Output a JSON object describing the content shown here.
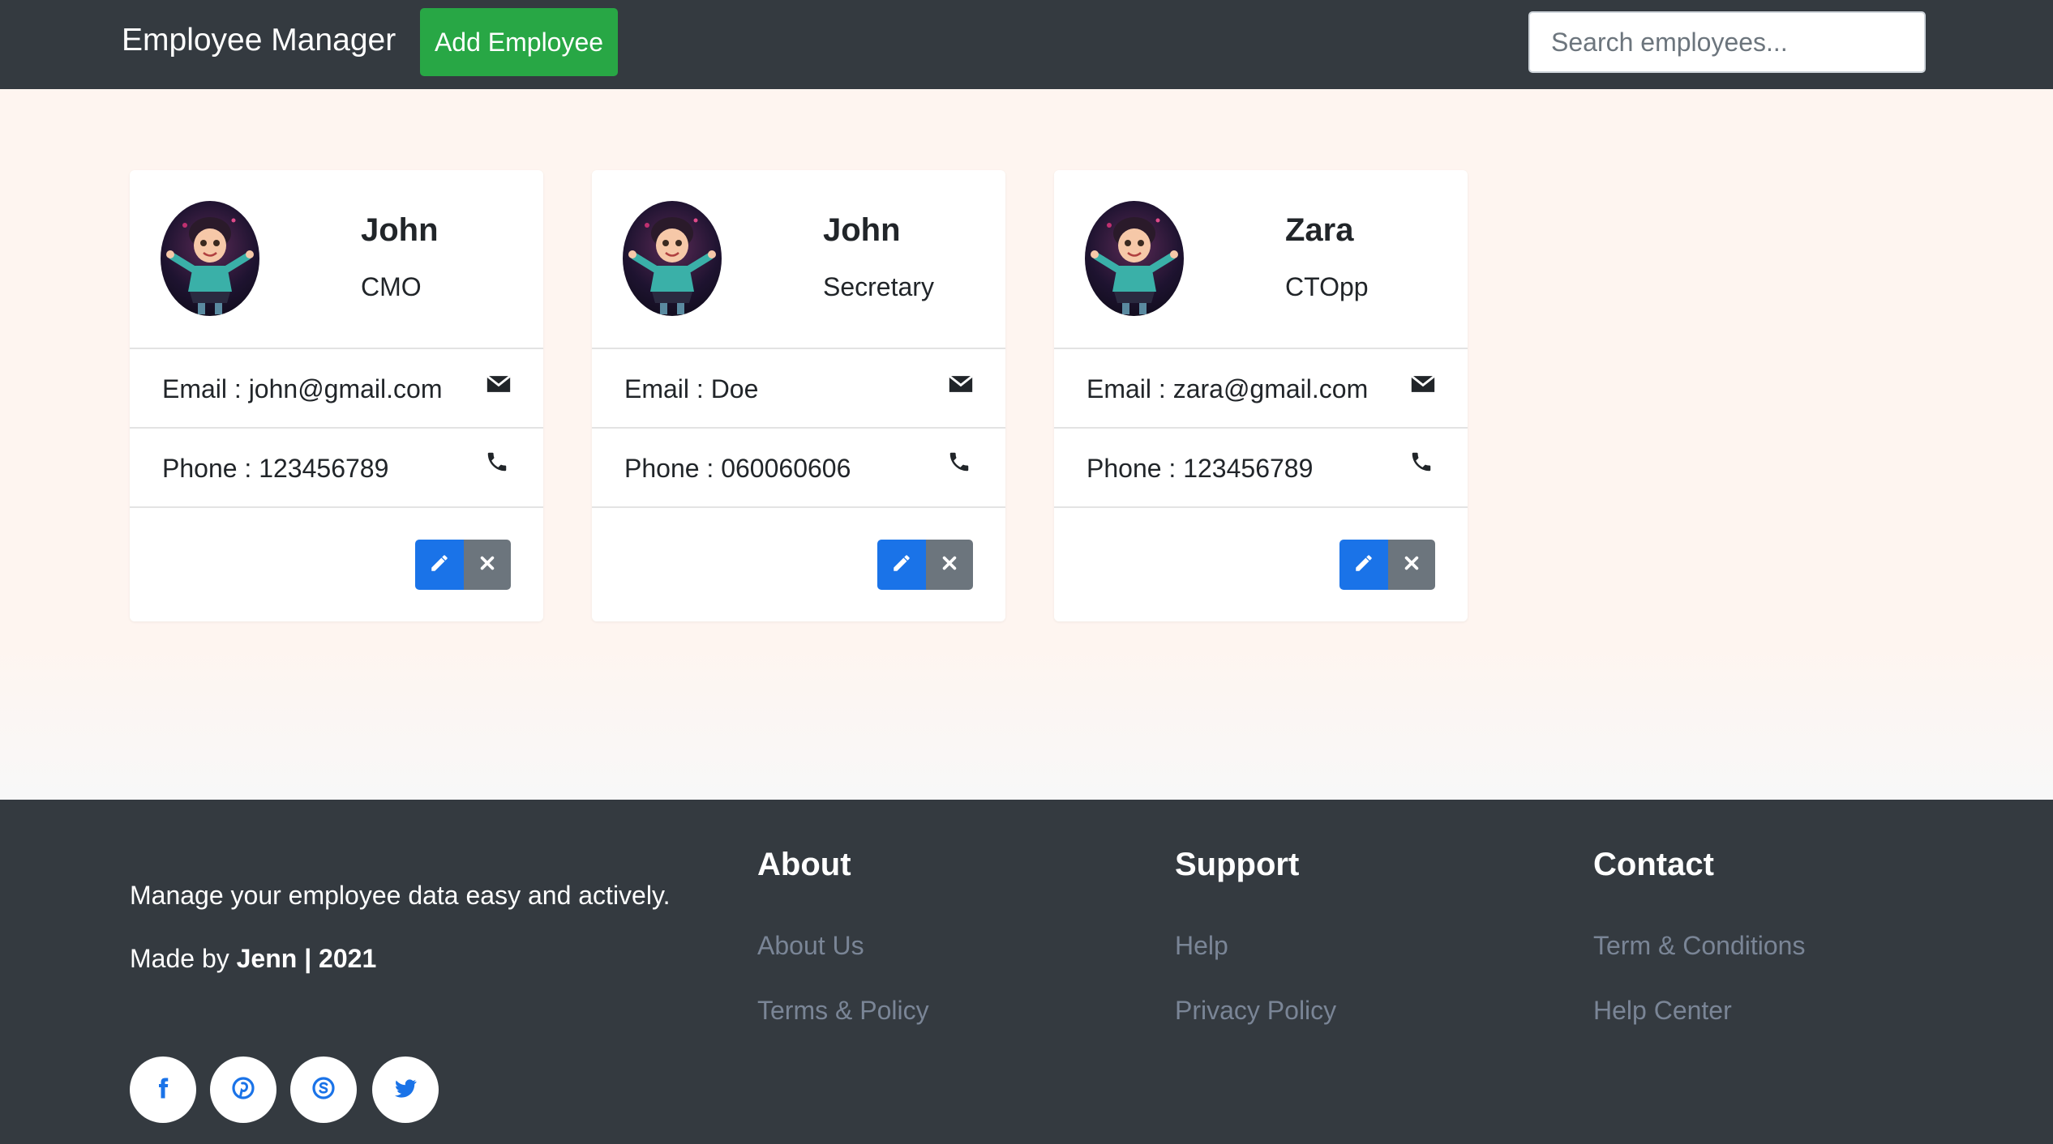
{
  "navbar": {
    "brand": "Employee Manager",
    "add_button": "Add Employee",
    "search_placeholder": "Search employees..."
  },
  "employees": [
    {
      "name": "John",
      "title": "CMO",
      "email_text": "Email : john@gmail.com",
      "phone_text": "Phone : 123456789"
    },
    {
      "name": "John",
      "title": "Secretary",
      "email_text": "Email : Doe",
      "phone_text": "Phone : 060060606"
    },
    {
      "name": "Zara",
      "title": "CTOpp",
      "email_text": "Email : zara@gmail.com",
      "phone_text": "Phone : 123456789"
    }
  ],
  "icons": {
    "email": "envelope-icon",
    "phone": "phone-icon",
    "edit": "pencil-icon",
    "delete": "close-icon",
    "social": [
      "facebook-icon",
      "pinterest-icon",
      "skype-icon",
      "twitter-icon"
    ]
  },
  "footer": {
    "tagline": "Manage your employee data easy and actively.",
    "made_by_prefix": "Made by ",
    "made_by_bold": "Jenn | 2021",
    "columns": [
      {
        "title": "About",
        "links": [
          "About Us",
          "Terms & Policy"
        ]
      },
      {
        "title": "Support",
        "links": [
          "Help",
          "Privacy Policy"
        ]
      },
      {
        "title": "Contact",
        "links": [
          "Term & Conditions",
          "Help Center"
        ]
      }
    ]
  },
  "colors": {
    "navbar_bg": "#343a40",
    "add_button": "#28a745",
    "page_bg": "#fef5f0",
    "edit_button": "#1a73e8",
    "delete_button": "#6c757d",
    "social_icon": "#1a73e8",
    "footer_link": "#7a8596"
  }
}
